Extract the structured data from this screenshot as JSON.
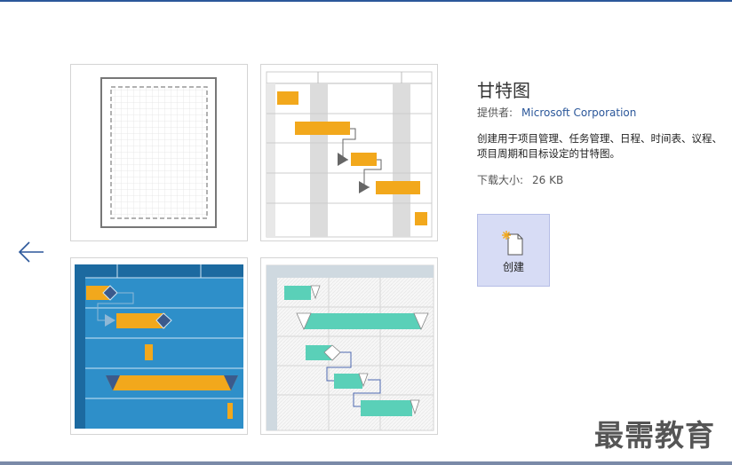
{
  "template": {
    "title": "甘特图",
    "provider_label": "提供者:",
    "provider_value": "Microsoft Corporation",
    "description": "创建用于项目管理、任务管理、日程、时间表、议程、项目周期和目标设定的甘特图。",
    "size_label": "下载大小:",
    "size_value": "26 KB"
  },
  "actions": {
    "create_label": "创建"
  },
  "watermark": "最需教育",
  "icons": {
    "back": "arrow-left-icon",
    "create": "new-document-icon"
  },
  "colors": {
    "accent": "#2b579a",
    "gantt_orange": "#f2a81c",
    "gantt_blue": "#2e8fc9",
    "gantt_teal": "#5ad0b8",
    "create_bg": "#d7dcf5"
  }
}
